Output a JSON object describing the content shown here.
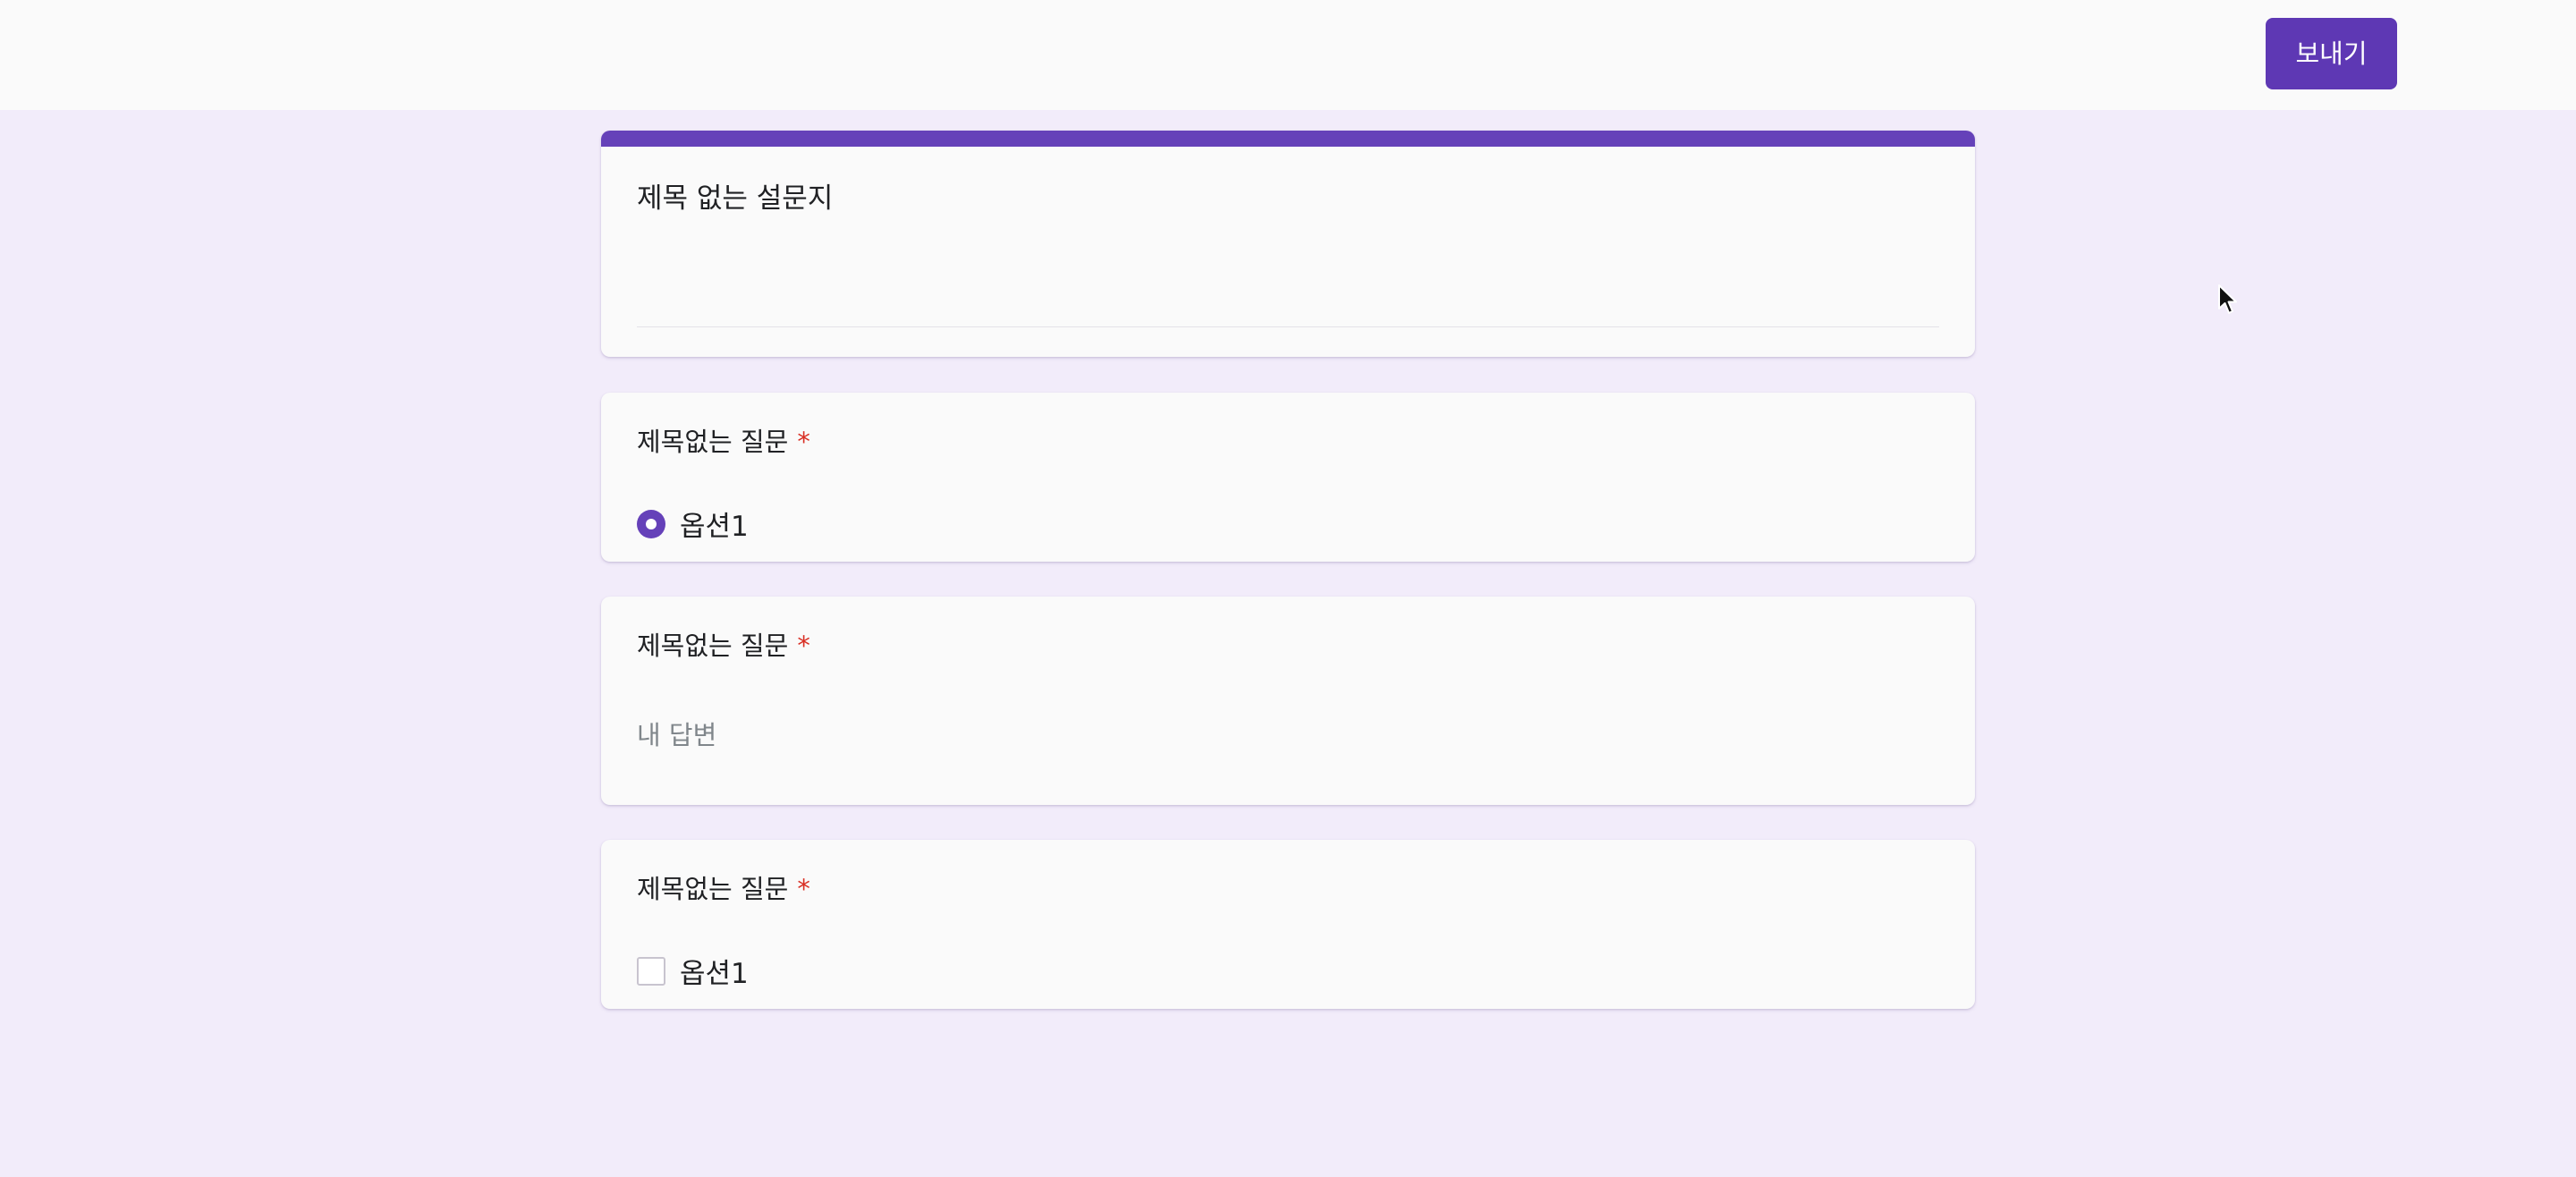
{
  "header": {
    "send_label": "보내기"
  },
  "form": {
    "title": "제목 없는 설문지",
    "accent_color": "#6541b9"
  },
  "questions": [
    {
      "label": "제목없는 질문",
      "required_mark": "*",
      "type": "radio",
      "options": [
        {
          "label": "옵션1",
          "selected": true
        }
      ]
    },
    {
      "label": "제목없는 질문",
      "required_mark": "*",
      "type": "short_answer",
      "placeholder": "내 답변",
      "value": ""
    },
    {
      "label": "제목없는 질문",
      "required_mark": "*",
      "type": "checkbox",
      "options": [
        {
          "label": "옵션1",
          "checked": false
        }
      ]
    }
  ],
  "colors": {
    "brand": "#5e38b4",
    "background": "#f2ecfa",
    "required": "#d93025"
  },
  "icons": {
    "cursor": "mouse-pointer-icon"
  }
}
